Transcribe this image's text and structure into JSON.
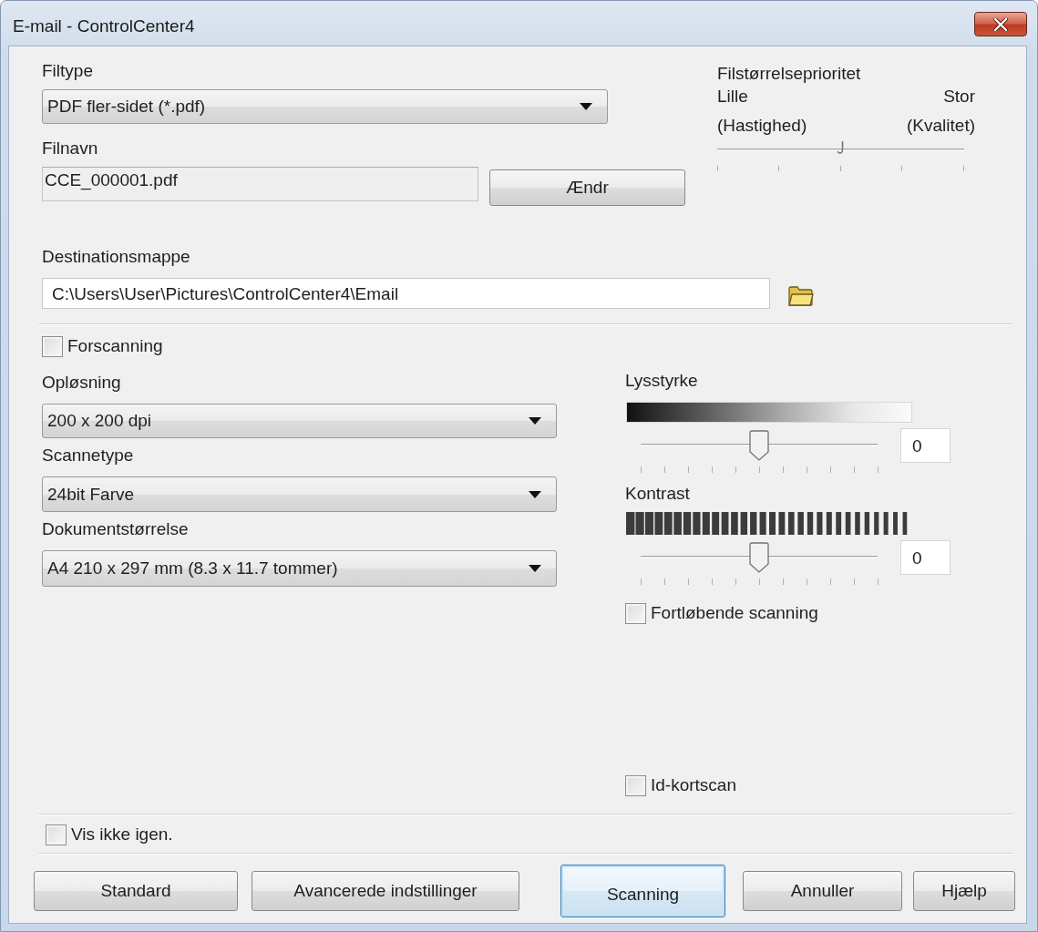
{
  "window": {
    "title": "E-mail - ControlCenter4"
  },
  "file_type": {
    "label": "Filtype",
    "value": "PDF fler-sidet (*.pdf)"
  },
  "file_name": {
    "label": "Filnavn",
    "value": "CCE_000001.pdf",
    "button": "Ændr"
  },
  "file_size_priority": {
    "label": "Filstørrelseprioritet",
    "min_label": "Lille",
    "max_label": "Stor",
    "min_hint": "(Hastighed)",
    "max_hint": "(Kvalitet)",
    "level": 0.5
  },
  "destination_folder": {
    "label": "Destinationsmappe",
    "value": "C:\\Users\\User\\Pictures\\ControlCenter4\\Email"
  },
  "prescan": {
    "label": "Forscanning",
    "checked": false
  },
  "settings": [
    {
      "label": "Opløsning",
      "value": "200 x 200 dpi"
    },
    {
      "label": "Scannetype",
      "value": "24bit Farve"
    },
    {
      "label": "Dokumentstørrelse",
      "value": "A4 210 x 297 mm (8.3 x 11.7 tommer)"
    }
  ],
  "adjustments": [
    {
      "kind": "gradient",
      "label": "Lysstyrke",
      "level": 0.5,
      "reading": "0"
    },
    {
      "kind": "stripes",
      "label": "Kontrast",
      "level": 0.5,
      "reading": "0"
    }
  ],
  "continuous_scanning": {
    "label": "Fortløbende scanning",
    "checked": false
  },
  "id_card_scan": {
    "label": "Id-kortscan",
    "checked": false
  },
  "dont_show_again": {
    "label": "Vis ikke igen.",
    "checked": false
  },
  "buttons": [
    {
      "label": "Standard",
      "default": false
    },
    {
      "label": "Avancerede indstillinger",
      "default": false
    },
    {
      "label": "Scanning",
      "default": true
    },
    {
      "label": "Annuller",
      "default": false
    },
    {
      "label": "Hjælp",
      "default": false
    }
  ]
}
